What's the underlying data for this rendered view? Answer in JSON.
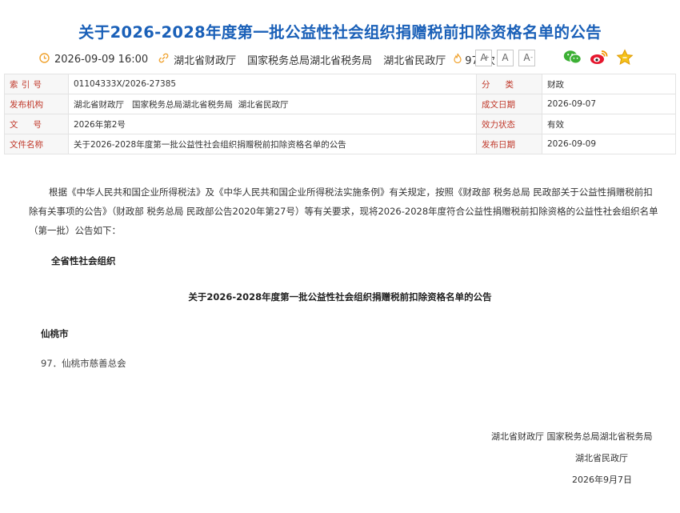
{
  "title": "关于2026-2028年度第一批公益性社会组织捐赠税前扣除资格名单的公告",
  "meta": {
    "date": "2026-09-09 16:00",
    "orgs": [
      "湖北省财政厅",
      "国家税务总局湖北省税务局",
      "湖北省民政厅"
    ],
    "views": "971次"
  },
  "font_buttons": {
    "large": "A",
    "medium": "A",
    "small": "A",
    "large_mark": "+",
    "small_mark": "-"
  },
  "info_table": {
    "index_label_chars": [
      "索",
      "引",
      "号"
    ],
    "index_value": "01104333X/2026-27385",
    "category_label_chars": [
      "分",
      "类"
    ],
    "category_value": "财政",
    "issuer_label": "发布机构",
    "issuer_value": "湖北省财政厅   国家税务总局湖北省税务局  湖北省民政厅",
    "created_label": "成文日期",
    "created_value": "2026-09-07",
    "docno_label_chars": [
      "文",
      "号"
    ],
    "docno_value": "2026年第2号",
    "status_label": "效力状态",
    "status_value": "有效",
    "filename_label": "文件名称",
    "filename_value": "关于2026-2028年度第一批公益性社会组织捐赠税前扣除资格名单的公告",
    "published_label": "发布日期",
    "published_value": "2026-09-09"
  },
  "body": {
    "paragraph": "根据《中华人民共和国企业所得税法》及《中华人民共和国企业所得税法实施条例》有关规定，按照《财政部 税务总局 民政部关于公益性捐赠税前扣除有关事项的公告》（财政部 税务总局 民政部公告2020年第27号）等有关要求，现将2026-2028年度符合公益性捐赠税前扣除资格的公益性社会组织名单（第一批）公告如下：",
    "section1": "全省性社会组织",
    "section_title": "关于2026-2028年度第一批公益性社会组织捐赠税前扣除资格名单的公告",
    "section2": "仙桃市",
    "item1": "97．仙桃市慈善总会"
  },
  "signature": {
    "line1": "湖北省财政厅  国家税务总局湖北省税务局",
    "line2": "湖北省民政厅",
    "line3": "2026年9月7日"
  }
}
